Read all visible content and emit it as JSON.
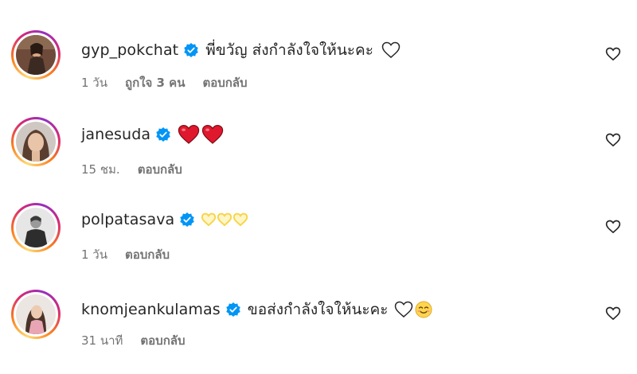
{
  "comments": [
    {
      "username": "gyp_pokchat",
      "text": "พี่ขวัญ ส่งกำลังใจให้นะคะ",
      "emojis": [
        "white-heart"
      ],
      "time": "1 วัน",
      "likes": "ถูกใจ 3 คน",
      "reply": "ตอบกลับ"
    },
    {
      "username": "janesuda",
      "text": "",
      "emojis": [
        "red-heart",
        "red-heart"
      ],
      "time": "15 ชม.",
      "likes": "",
      "reply": "ตอบกลับ"
    },
    {
      "username": "polpatasava",
      "text": "",
      "emojis": [
        "yellow-heart-outline",
        "yellow-heart-outline",
        "yellow-heart-outline"
      ],
      "time": "1 วัน",
      "likes": "",
      "reply": "ตอบกลับ"
    },
    {
      "username": "knomjeankulamas",
      "text": "ขอส่งกำลังใจให้นะคะ",
      "emojis": [
        "white-heart",
        "smiling-face-with-smiling-eyes"
      ],
      "time": "31 นาที",
      "likes": "",
      "reply": "ตอบกลับ"
    }
  ],
  "colors": {
    "verified": "#0095f6",
    "meta_text": "#737373",
    "primary_text": "#262626",
    "red_heart": "#e0182d",
    "yellow_heart": "#f7d54a"
  }
}
